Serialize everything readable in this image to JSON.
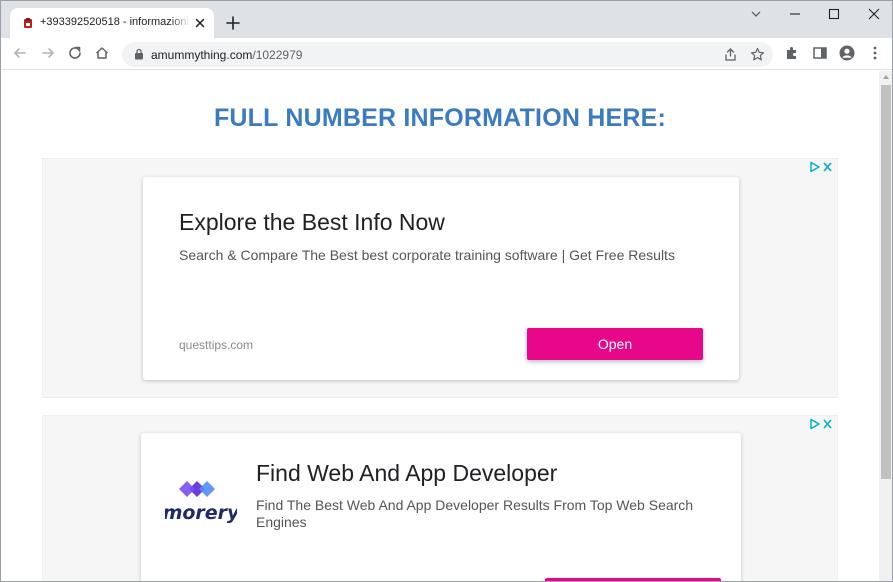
{
  "browser": {
    "tab": {
      "title": "+393392520518 - informazioni c",
      "close_label": "Close tab"
    },
    "new_tab_label": "+",
    "address": {
      "host": "amummything.com",
      "path": "/1022979"
    }
  },
  "page": {
    "heading": "FULL NUMBER INFORMATION HERE:"
  },
  "ads": [
    {
      "title": "Explore the Best Info Now",
      "description": "Search & Compare The Best best corporate training software | Get Free Results",
      "display_url": "questtips.com",
      "cta": "Open"
    },
    {
      "logo_text": "morery",
      "title": "Find Web And App Developer",
      "description": "Find The Best Web And App Developer Results From Top Web Search Engines",
      "cta": ""
    }
  ],
  "colors": {
    "heading": "#3b7bbf",
    "cta": "#e6078a",
    "adchoices": "#00aecd",
    "morery_text": "#1f2a6b"
  }
}
